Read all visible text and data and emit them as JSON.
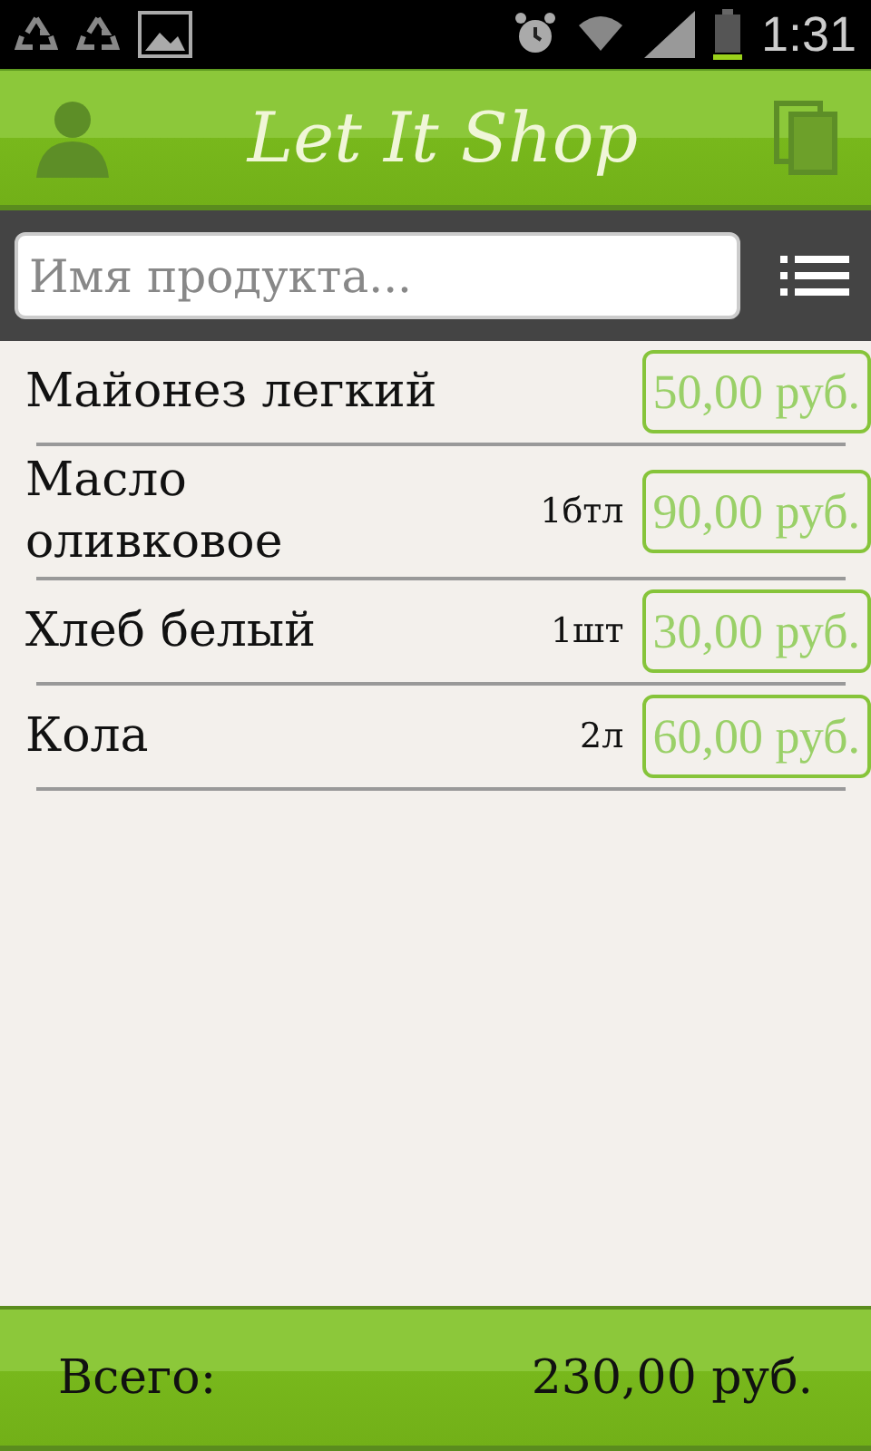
{
  "status_bar": {
    "time": "1:31"
  },
  "header": {
    "title": "Let It Shop"
  },
  "search": {
    "placeholder": "Имя продукта..."
  },
  "items": [
    {
      "name": "Майонез легкий",
      "price": "50,00 руб."
    },
    {
      "name": "Масло оливковое",
      "quantity": "1бтл",
      "price": "90,00 руб."
    },
    {
      "name": "Хлеб белый",
      "quantity": "1шт",
      "price": "30,00 руб."
    },
    {
      "name": "Кола",
      "quantity": "2л",
      "price": "60,00 руб."
    }
  ],
  "footer": {
    "label": "Всего:",
    "total": "230,00 руб."
  }
}
